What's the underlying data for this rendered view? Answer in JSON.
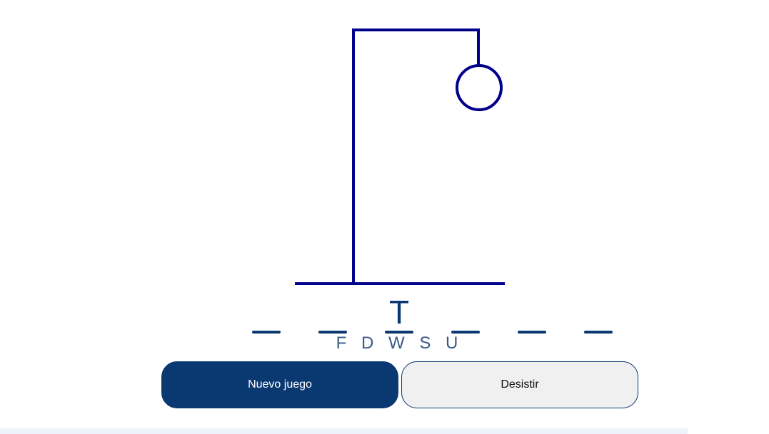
{
  "colors": {
    "drawing": "#00008b",
    "accent": "#0a3871",
    "button_secondary_bg": "#f0f0f0"
  },
  "hangman_stage": "head",
  "word": {
    "slots": [
      "",
      "",
      "T",
      "",
      "",
      ""
    ]
  },
  "wrong_letters": "F D W S U",
  "buttons": {
    "new_game": "Nuevo juego",
    "give_up": "Desistir"
  }
}
